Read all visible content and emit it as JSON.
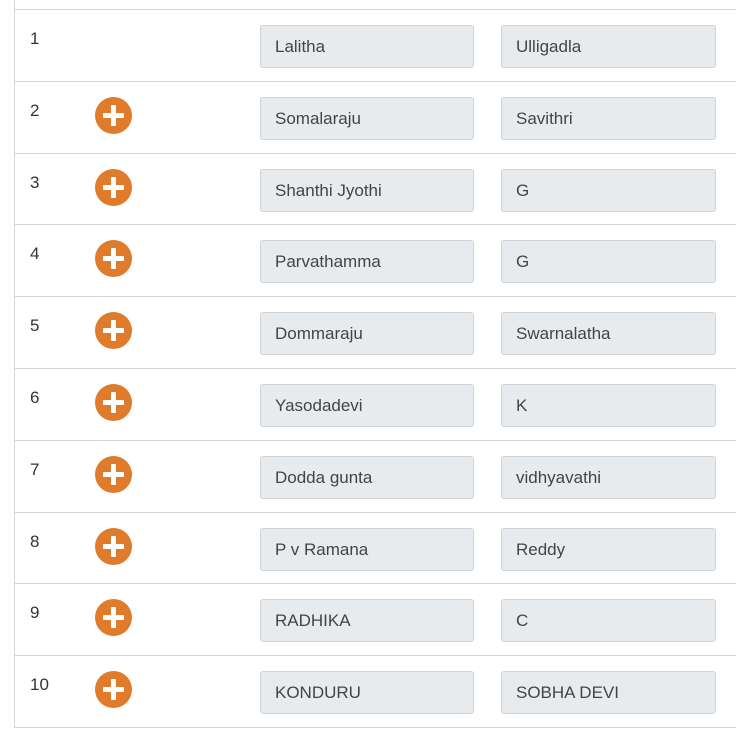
{
  "accent_color": "#e07b2c",
  "add_icon": "plus-circle-icon",
  "rows": [
    {
      "num": "1",
      "first": "Lalitha",
      "last": "Ulligadla",
      "has_add": false
    },
    {
      "num": "2",
      "first": "Somalaraju",
      "last": "Savithri",
      "has_add": true
    },
    {
      "num": "3",
      "first": "Shanthi Jyothi",
      "last": "G",
      "has_add": true
    },
    {
      "num": "4",
      "first": "Parvathamma",
      "last": "G",
      "has_add": true
    },
    {
      "num": "5",
      "first": "Dommaraju",
      "last": "Swarnalatha",
      "has_add": true
    },
    {
      "num": "6",
      "first": "Yasodadevi",
      "last": "K",
      "has_add": true
    },
    {
      "num": "7",
      "first": "Dodda gunta",
      "last": "vidhyavathi",
      "has_add": true
    },
    {
      "num": "8",
      "first": "P v Ramana",
      "last": "Reddy",
      "has_add": true
    },
    {
      "num": "9",
      "first": "RADHIKA",
      "last": "C",
      "has_add": true
    },
    {
      "num": "10",
      "first": "KONDURU",
      "last": "SOBHA DEVI",
      "has_add": true
    }
  ]
}
